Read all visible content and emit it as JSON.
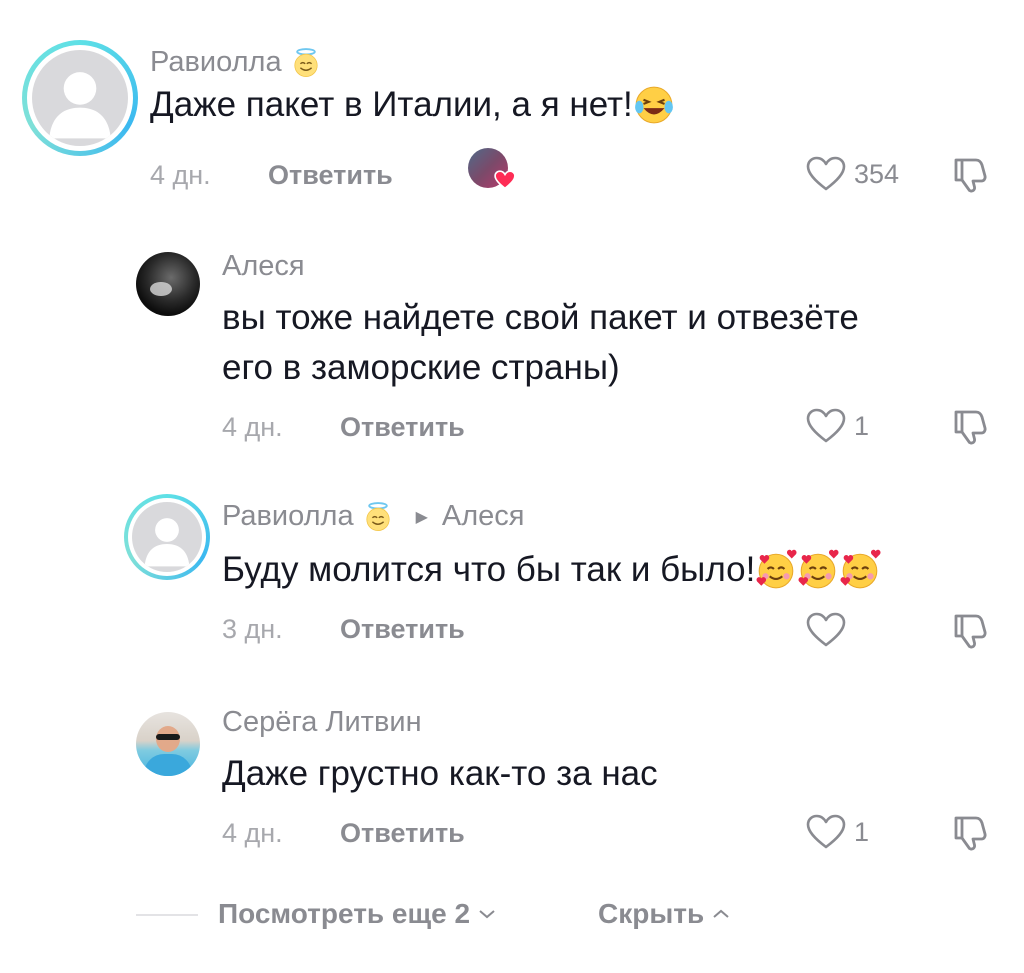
{
  "comments": [
    {
      "username": "Равиолла",
      "text": "Даже пакет в Италии, а я нет!",
      "time": "4 дн.",
      "reply_label": "Ответить",
      "likes": "354"
    },
    {
      "username": "Алеся",
      "text_line1": "вы тоже найдете свой пакет и отвезёте",
      "text_line2": "его в заморские страны)",
      "time": "4 дн.",
      "reply_label": "Ответить",
      "likes": "1"
    },
    {
      "username": "Равиолла",
      "reply_to": "Алеся",
      "text": "Буду молится что бы так и было!",
      "time": "3 дн.",
      "reply_label": "Ответить",
      "likes": ""
    },
    {
      "username": "Серёга Литвин",
      "text": "Даже грустно как-то за нас",
      "time": "4 дн.",
      "reply_label": "Ответить",
      "likes": "1"
    }
  ],
  "footer": {
    "view_more": "Посмотреть еще 2",
    "hide": "Скрыть"
  },
  "icons": {
    "like": "heart-outline-icon",
    "dislike": "thumbs-down-icon",
    "angel_emoji": "smiling-face-with-halo-emoji",
    "laugh_emoji": "face-with-tears-of-joy-emoji",
    "love_emoji": "smiling-face-with-hearts-emoji"
  },
  "colors": {
    "avatar_ring": "#3bb8f0",
    "creator_like_heart": "#fe2c55"
  }
}
